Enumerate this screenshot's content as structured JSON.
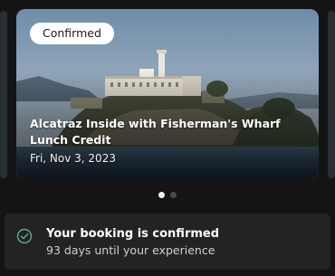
{
  "booking_card": {
    "status_badge": "Confirmed",
    "title": "Alcatraz Inside with Fisherman's Wharf Lunch Credit",
    "date": "Fri, Nov 3, 2023",
    "image_icon": "alcatraz-island-photo"
  },
  "carousel": {
    "page_count": 2,
    "active_index": 0
  },
  "confirmation": {
    "icon": "check-circle-icon",
    "title": "Your booking is confirmed",
    "subtitle": "93 days until your experience"
  },
  "colors": {
    "background": "#141414",
    "panel": "#232323",
    "accent_check": "#5fae8a",
    "badge_bg": "#ffffff"
  }
}
